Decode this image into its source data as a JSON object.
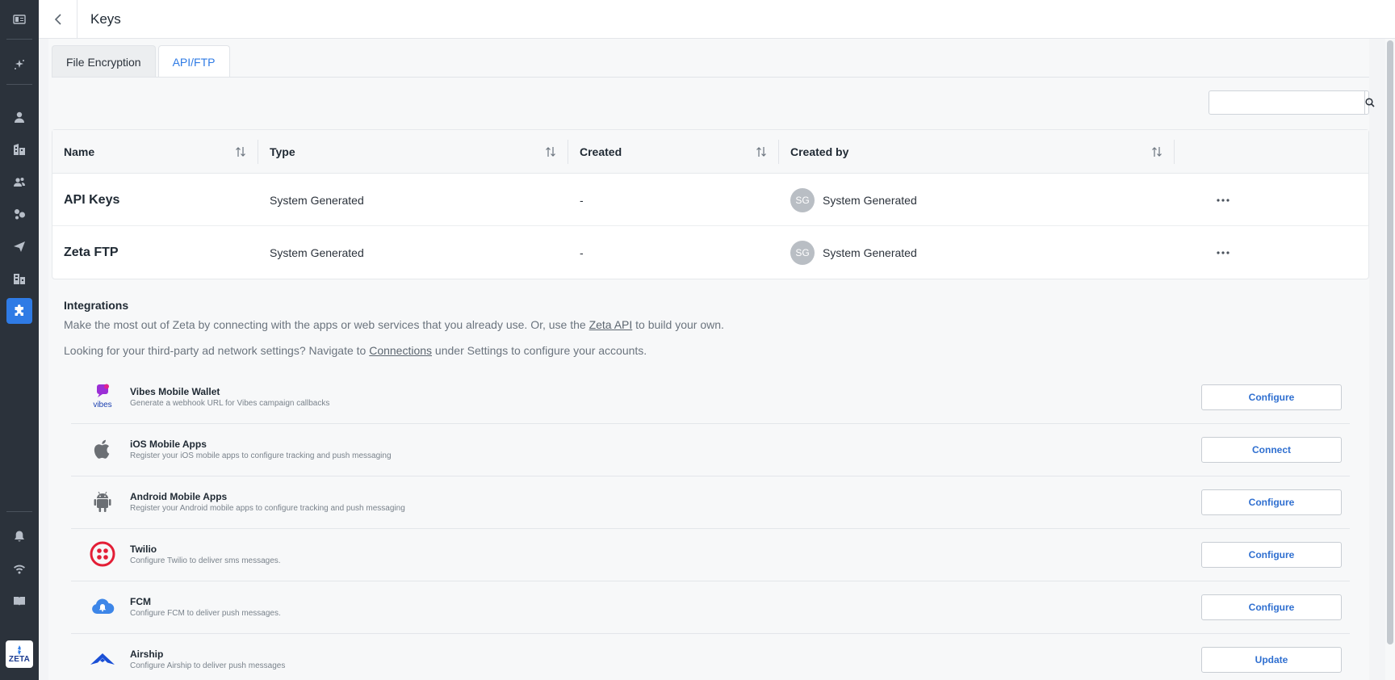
{
  "sidebar": {
    "items": [
      {
        "icon": "panel-toggle-icon"
      },
      {
        "icon": "sparkle-icon"
      },
      {
        "icon": "person-icon"
      },
      {
        "icon": "building-icon"
      },
      {
        "icon": "audience-icon"
      },
      {
        "icon": "segments-icon"
      },
      {
        "icon": "send-icon"
      },
      {
        "icon": "org-icon"
      },
      {
        "icon": "puzzle-icon",
        "active": true
      },
      {
        "icon": "bell-icon"
      },
      {
        "icon": "signal-icon"
      },
      {
        "icon": "book-icon"
      }
    ],
    "logo_text": "ZETA"
  },
  "header": {
    "title": "Keys"
  },
  "tabs": [
    {
      "label": "File Encryption",
      "active": false
    },
    {
      "label": "API/FTP",
      "active": true
    }
  ],
  "search": {
    "value": "",
    "placeholder": ""
  },
  "table": {
    "columns": [
      "Name",
      "Type",
      "Created",
      "Created by"
    ],
    "rows": [
      {
        "name": "API Keys",
        "type": "System Generated",
        "created": "-",
        "avatar": "SG",
        "created_by": "System Generated"
      },
      {
        "name": "Zeta FTP",
        "type": "System Generated",
        "created": "-",
        "avatar": "SG",
        "created_by": "System Generated"
      }
    ]
  },
  "integrations": {
    "title": "Integrations",
    "desc_before": "Make the most out of Zeta by connecting with the apps or web services that you already use. Or, use the ",
    "desc_link": "Zeta API",
    "desc_after": " to build your own.",
    "desc2_before": "Looking for your third-party ad network settings? Navigate to ",
    "desc2_link": "Connections",
    "desc2_after": " under Settings to configure your accounts.",
    "items": [
      {
        "name": "Vibes Mobile Wallet",
        "sub": "Generate a webhook URL for Vibes campaign callbacks",
        "button": "Configure",
        "icon": "vibes-logo-icon",
        "icon_text": "vibes"
      },
      {
        "name": "iOS Mobile Apps",
        "sub": "Register your iOS mobile apps to configure tracking and push messaging",
        "button": "Connect",
        "icon": "apple-icon"
      },
      {
        "name": "Android Mobile Apps",
        "sub": "Register your Android mobile apps to configure tracking and push messaging",
        "button": "Configure",
        "icon": "android-icon"
      },
      {
        "name": "Twilio",
        "sub": "Configure Twilio to deliver sms messages.",
        "button": "Configure",
        "icon": "twilio-icon"
      },
      {
        "name": "FCM",
        "sub": "Configure FCM to deliver push messages.",
        "button": "Configure",
        "icon": "fcm-cloud-icon"
      },
      {
        "name": "Airship",
        "sub": "Configure Airship to deliver push messages",
        "button": "Update",
        "icon": "airship-icon"
      }
    ]
  },
  "colors": {
    "accent": "#2f7be5",
    "sidebar_bg": "#2b323b",
    "twilio": "#e31e36",
    "vibes": "#9b2fd6",
    "airship": "#1a4fd6"
  }
}
